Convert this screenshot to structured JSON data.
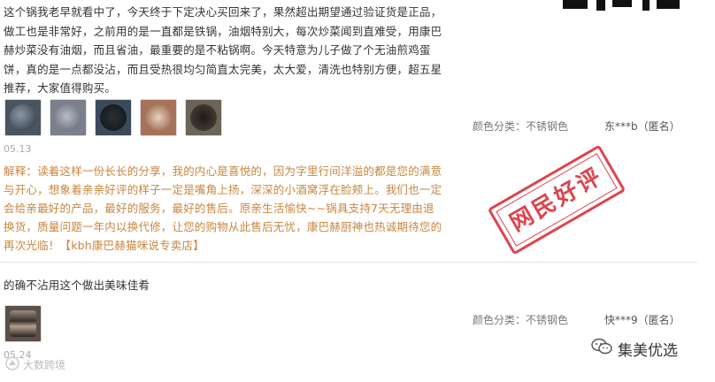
{
  "review1": {
    "text": "这个锅我老早就看中了，今天终于下定决心买回来了，果然超出期望通过验证货是正品，做工也是非常好，之前用的是一直都是铁锅，油烟特别大，每次炒菜闻到直难受，用康巴赫炒菜没有油烟，而且省油，最重要的是不粘锅啊。今天特意为儿子做了个无油煎鸡蛋饼，真的是一点都没沾，而且受热很均匀简直太完美，太大爱，清洗也特别方便，超五星推荐，大家值得购买。",
    "date": "05.13",
    "reply": "解释：读着这样一份长长的分享，我的内心是喜悦的，因为字里行间洋溢的都是您的满意与开心，想象着亲亲好评的样子一定是嘴角上扬，深深的小酒窝浮在脸颊上。我们也一定会给亲最好的产品，最好的服务，最好的售后。原亲生活愉快~~锅具支持7天无理由退换货，质量问题一年内以换代修，让您的购物从此售后无忧，康巴赫厨神也热诚期待您的再次光临！【kbh康巴赫猫咪说专卖店】",
    "sku": "颜色分类：不锈钢色",
    "user": "东***b（匿名）"
  },
  "review2": {
    "text": "的确不沾用这个做出美味佳肴",
    "date": "05.24",
    "sku": "颜色分类：不锈钢色",
    "user": "快***9（匿名）"
  },
  "stamp": {
    "text": "网民好评"
  },
  "watermark_right": {
    "text": "集美优选"
  },
  "watermark_left": {
    "text": "大数跨境"
  },
  "colors": {
    "reply": "#c8863f",
    "stamp": "#d9363e"
  }
}
